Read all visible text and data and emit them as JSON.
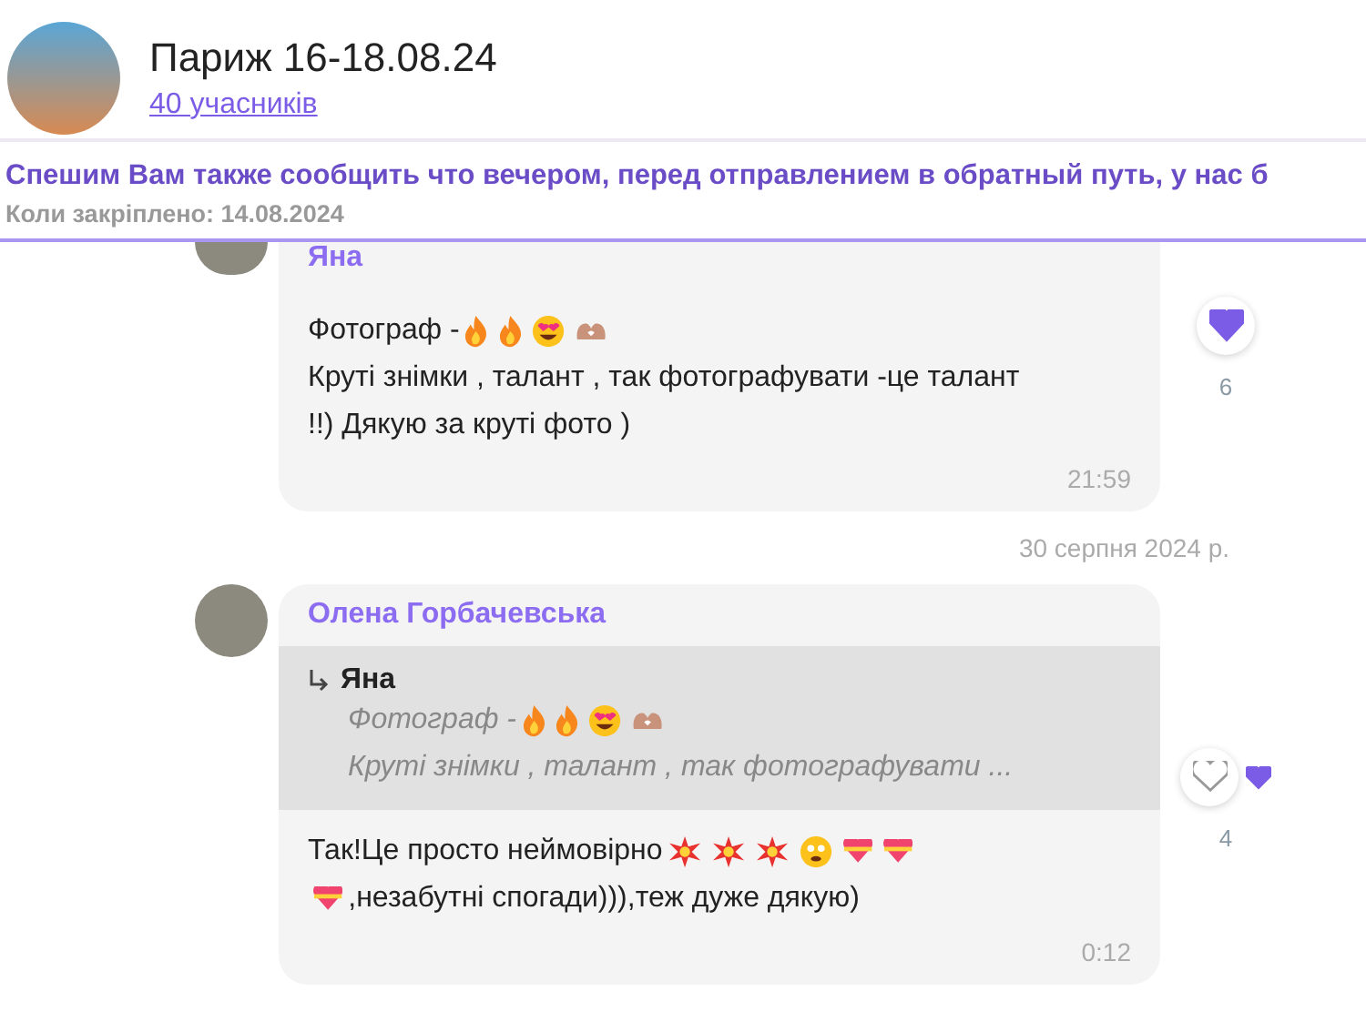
{
  "header": {
    "title": "Париж 16-18.08.24",
    "members": "40 учасників"
  },
  "pinned": {
    "text": "Спешим Вам также сообщить что вечером, перед отправлением в обратный путь, у нас б",
    "date": "Коли закріплено: 14.08.2024"
  },
  "items": [
    {
      "kind": "message",
      "author": "Яна",
      "time": "21:59",
      "lines": [
        [
          {
            "kind": "text",
            "text": "Фотограф - "
          },
          {
            "kind": "fire"
          },
          {
            "kind": "fire"
          },
          {
            "kind": "heart-eyes"
          },
          {
            "kind": "heart-hands"
          }
        ],
        [
          {
            "kind": "text",
            "text": "Круті знімки , талант , так фотографувати -це талант"
          }
        ],
        [
          {
            "kind": "text",
            "text": "!!) Дякую за круті фото )"
          }
        ]
      ],
      "reaction": {
        "selected": true,
        "count": "6"
      }
    },
    {
      "kind": "date",
      "text": "30 серпня 2024 р."
    },
    {
      "kind": "message",
      "author": "Олена Горбачевська",
      "time": "0:12",
      "quote": {
        "author": "Яна",
        "lines": [
          [
            {
              "kind": "text",
              "text": "Фотограф - "
            },
            {
              "kind": "fire"
            },
            {
              "kind": "fire"
            },
            {
              "kind": "heart-eyes"
            },
            {
              "kind": "heart-hands"
            }
          ],
          [
            {
              "kind": "text",
              "text": "Круті знімки , талант , так фотографувати ..."
            }
          ]
        ]
      },
      "lines": [
        [
          {
            "kind": "text",
            "text": "Так!Це просто неймовірно"
          },
          {
            "kind": "collision"
          },
          {
            "kind": "collision"
          },
          {
            "kind": "collision"
          },
          {
            "kind": "tear-face"
          },
          {
            "kind": "heart-ribbon"
          },
          {
            "kind": "heart-ribbon"
          }
        ],
        [
          {
            "kind": "heart-ribbon"
          },
          {
            "kind": "text",
            "text": ",незабутні спогади))),теж дуже дякую)"
          }
        ]
      ],
      "reaction": {
        "selected": false,
        "count": "4"
      }
    }
  ]
}
